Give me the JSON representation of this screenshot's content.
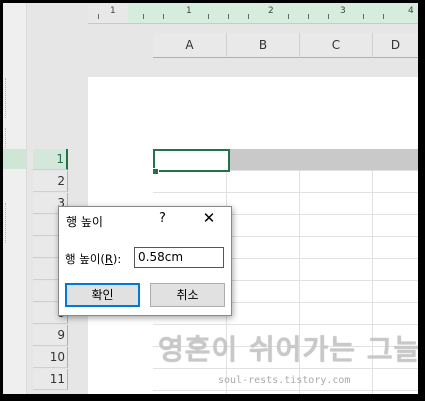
{
  "ruler": {
    "numbers": [
      "1",
      "1",
      "2",
      "3",
      "4"
    ]
  },
  "columns": [
    "A",
    "B",
    "C",
    "D"
  ],
  "rows": [
    "1",
    "2",
    "3",
    "4",
    "5",
    "6",
    "7",
    "8",
    "9",
    "10",
    "11"
  ],
  "dialog": {
    "title": "행 높이",
    "help": "?",
    "close": "✕",
    "label_prefix": "행 높이(",
    "label_mnemonic": "R",
    "label_suffix": "):",
    "value": "0.58cm",
    "ok": "확인",
    "cancel": "취소"
  },
  "watermark": {
    "text": "영혼이 쉬어가는 그늘",
    "url": "soul-rests.tistory.com"
  },
  "colors": {
    "excel_green": "#217346",
    "focus_blue": "#0078d7"
  }
}
